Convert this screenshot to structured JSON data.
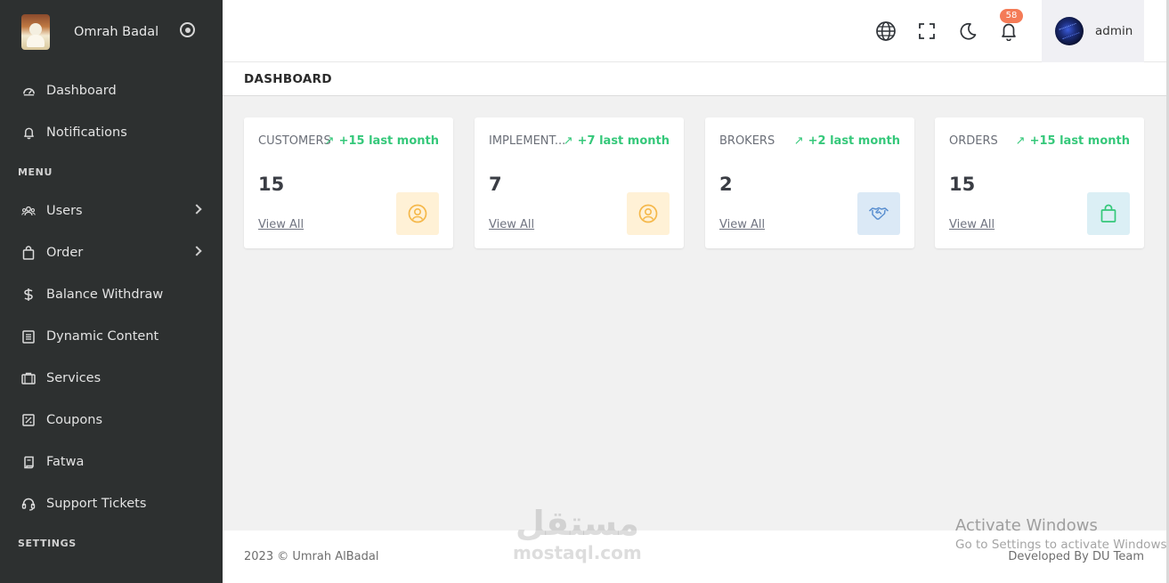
{
  "brand": {
    "name": "Omrah Badal"
  },
  "sidebar": {
    "items": [
      {
        "label": "Dashboard",
        "icon": "dashboard-icon",
        "has_submenu": false
      },
      {
        "label": "Notifications",
        "icon": "bell-icon",
        "has_submenu": false
      },
      {
        "label": "Users",
        "icon": "users-icon",
        "has_submenu": true
      },
      {
        "label": "Order",
        "icon": "bag-icon",
        "has_submenu": true
      },
      {
        "label": "Balance Withdraw",
        "icon": "dollar-icon",
        "has_submenu": false
      },
      {
        "label": "Dynamic Content",
        "icon": "document-icon",
        "has_submenu": false
      },
      {
        "label": "Services",
        "icon": "briefcase-icon",
        "has_submenu": false
      },
      {
        "label": "Coupons",
        "icon": "percent-icon",
        "has_submenu": false
      },
      {
        "label": "Fatwa",
        "icon": "scroll-icon",
        "has_submenu": false
      },
      {
        "label": "Support Tickets",
        "icon": "headset-icon",
        "has_submenu": false
      }
    ],
    "sections": {
      "menu": "MENU",
      "settings": "SETTINGS"
    }
  },
  "header": {
    "notification_count": "58",
    "user": {
      "name": "admin"
    }
  },
  "page": {
    "title": "DASHBOARD"
  },
  "cards": [
    {
      "title": "CUSTOMERS",
      "trend": "+15 last month",
      "count": "15",
      "link": "View All",
      "icon": "user-circle-icon",
      "icon_bg": "#fff1d6",
      "icon_color": "#f5b84a"
    },
    {
      "title": "IMPLEMENT...",
      "trend": "+7 last month",
      "count": "7",
      "link": "View All",
      "icon": "user-circle-icon",
      "icon_bg": "#fff1d6",
      "icon_color": "#f5b84a"
    },
    {
      "title": "BROKERS",
      "trend": "+2 last month",
      "count": "2",
      "link": "View All",
      "icon": "handshake-icon",
      "icon_bg": "#dbe9f6",
      "icon_color": "#5a8fd0"
    },
    {
      "title": "ORDERS",
      "trend": "+15 last month",
      "count": "15",
      "link": "View All",
      "icon": "shopping-bag-icon",
      "icon_bg": "#dbeff5",
      "icon_color": "#35c87a"
    }
  ],
  "colors": {
    "sidebar_bg": "#2d3030",
    "trend_green": "#35c87a",
    "badge": "#f47b57"
  },
  "footer": {
    "copyright": "2023 © Umrah AlBadal",
    "developer": "Developed By DU Team"
  },
  "watermark": {
    "arabic": "مستقل",
    "latin": "mostaql.com"
  },
  "os_notice": {
    "title": "Activate Windows",
    "subtitle": "Go to Settings to activate Windows."
  }
}
